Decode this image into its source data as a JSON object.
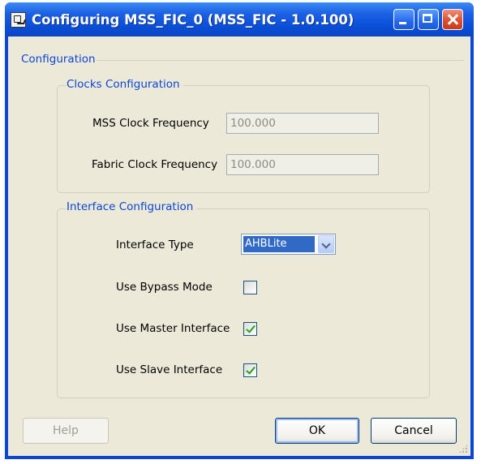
{
  "window": {
    "title": "Configuring MSS_FIC_0 (MSS_FIC - 1.0.100)"
  },
  "configuration": {
    "label": "Configuration",
    "clocks": {
      "label": "Clocks Configuration",
      "mss_clock_label": "MSS Clock Frequency",
      "mss_clock_value": "100.000",
      "fabric_clock_label": "Fabric Clock Frequency",
      "fabric_clock_value": "100.000"
    },
    "interface": {
      "label": "Interface Configuration",
      "type_label": "Interface Type",
      "type_value": "AHBLite",
      "bypass_label": "Use Bypass Mode",
      "bypass_checked": false,
      "master_label": "Use Master Interface",
      "master_checked": true,
      "slave_label": "Use Slave Interface",
      "slave_checked": true
    }
  },
  "buttons": {
    "help": "Help",
    "ok": "OK",
    "cancel": "Cancel"
  },
  "colors": {
    "title_bar": "#0a4fd8",
    "group_label": "#0a46d5",
    "dialog_bg": "#ece9d8",
    "check_mark": "#21a121",
    "combo_selection": "#316ac5"
  }
}
